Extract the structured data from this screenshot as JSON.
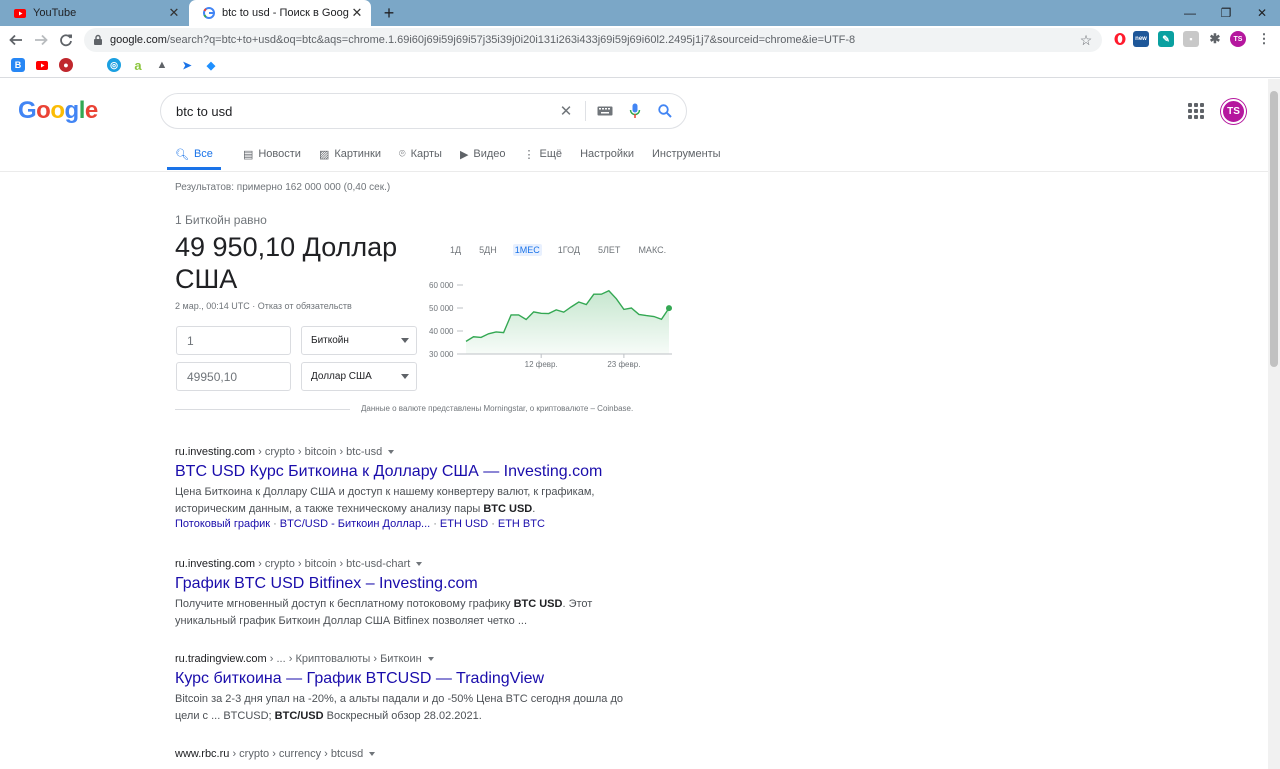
{
  "browser": {
    "tabs": [
      {
        "title": "YouTube",
        "active": false
      },
      {
        "title": "btc to usd - Поиск в Google",
        "active": true
      }
    ],
    "url_host": "google.com",
    "url_path": "/search?q=btc+to+usd&oq=btc&aqs=chrome.1.69i60j69i59j69i57j35i39j0i20i131i263i433j69i59j69i60l2.2495j1j7&sourceid=chrome&ie=UTF-8",
    "profile_initials": "TS"
  },
  "search": {
    "logo": "Google",
    "query": "btc to usd",
    "profile_initials": "TS",
    "tabs": [
      {
        "label": "Все",
        "icon": "search-icon"
      },
      {
        "label": "Новости",
        "icon": "news-icon"
      },
      {
        "label": "Картинки",
        "icon": "image-icon"
      },
      {
        "label": "Карты",
        "icon": "map-pin-icon"
      },
      {
        "label": "Видео",
        "icon": "video-icon"
      },
      {
        "label": "Ещё",
        "icon": "more-vert-icon"
      },
      {
        "label": "Настройки"
      },
      {
        "label": "Инструменты"
      }
    ],
    "stats": "Результатов: примерно 162 000 000 (0,40 сек.)"
  },
  "converter": {
    "subtitle": "1 Биткойн равно",
    "value_line1": "49 950,10 Доллар",
    "value_line2": "США",
    "date": "2 мар., 00:14 UTC",
    "disclaimer": "Отказ от обязательств",
    "from_amount": "1",
    "from_currency": "Биткойн",
    "to_amount": "49950,10",
    "to_currency": "Доллар США",
    "ranges": [
      "1Д",
      "5ДН",
      "1МЕС",
      "1ГОД",
      "5ЛЕТ",
      "МАКС."
    ],
    "active_range": "1МЕС",
    "note": "Данные о валюте представлены Morningstar, о криптовалюте – Coinbase."
  },
  "chart_data": {
    "type": "area",
    "title": "",
    "xlabel": "",
    "ylabel": "",
    "ylim": [
      30000,
      60000
    ],
    "yticks": [
      "60 000",
      "50 000",
      "40 000",
      "30 000"
    ],
    "ytick_values": [
      60000,
      50000,
      40000,
      30000
    ],
    "xticks": [
      "12 февр.",
      "23 февр."
    ],
    "xtick_index": [
      10,
      21
    ],
    "series": [
      {
        "values": [
          35500,
          37500,
          37200,
          38800,
          39600,
          39300,
          47000,
          47000,
          45000,
          48300,
          47700,
          47600,
          49200,
          48200,
          50500,
          52600,
          51500,
          56000,
          56000,
          57500,
          54000,
          49400,
          50000,
          47200,
          46700,
          46300,
          45100,
          49950
        ]
      }
    ],
    "colors": {
      "line": "#34a853",
      "fill": "#e6f4ea"
    },
    "grid": false
  },
  "results": [
    {
      "host": "ru.investing.com",
      "crumbs": " › crypto › bitcoin › btc-usd",
      "title": "BTC USD Курс Биткоина к Доллару США — Investing.com",
      "snippet_pre": "Цена Биткоина к Доллару США и доступ к нашему конвертеру валют, к графикам, историческим данным, а также техническому анализу пары ",
      "snippet_bold": "BTC USD",
      "snippet_post": ".",
      "links": [
        "Потоковый график",
        "BTC/USD - Биткоин Доллар...",
        "ETH USD",
        "ETH BTC"
      ]
    },
    {
      "host": "ru.investing.com",
      "crumbs": " › crypto › bitcoin › btc-usd-chart",
      "title": "График BTC USD Bitfinex – Investing.com",
      "snippet_pre": "Получите мгновенный доступ к бесплатному потоковому графику ",
      "snippet_bold": "BTC USD",
      "snippet_post": ". Этот уникальный график Биткоин Доллар США Bitfinex позволяет четко ..."
    },
    {
      "host": "ru.tradingview.com",
      "crumbs": " › ... › Криптовалюты › Биткоин",
      "title": "Курс биткоина — График BTCUSD — TradingView",
      "snippet_pre": "Bitcoin за 2-3 дня упал на -20%, а альты падали и до -50% Цена BTC сегодня дошла до цели с ... BTCUSD; ",
      "snippet_bold": "BTC/USD",
      "snippet_post": " Воскресный обзор 28.02.2021."
    },
    {
      "host": "www.rbc.ru",
      "crumbs": " › crypto › currency › btcusd"
    }
  ]
}
